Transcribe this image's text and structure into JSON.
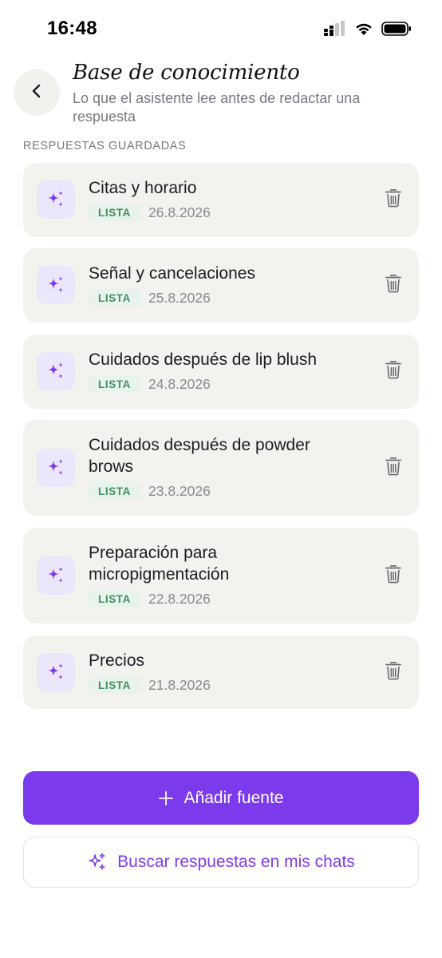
{
  "status_bar": {
    "time": "16:48",
    "icons": [
      "cellular-signal-icon",
      "wifi-icon",
      "battery-icon"
    ]
  },
  "header": {
    "back_icon": "chevron-left-icon",
    "title": "Base de conocimiento",
    "subtitle": "Lo que el asistente lee antes de redactar una respuesta"
  },
  "section_label": "RESPUESTAS GUARDADAS",
  "items": [
    {
      "title": "Citas y horario",
      "badge": "LISTA",
      "date": "26.8.2026"
    },
    {
      "title": "Señal y cancelaciones",
      "badge": "LISTA",
      "date": "25.8.2026"
    },
    {
      "title": "Cuidados después de lip blush",
      "badge": "LISTA",
      "date": "24.8.2026"
    },
    {
      "title": "Cuidados después de powder brows",
      "badge": "LISTA",
      "date": "23.8.2026"
    },
    {
      "title": "Preparación para micropigmentación",
      "badge": "LISTA",
      "date": "22.8.2026"
    },
    {
      "title": "Precios",
      "badge": "LISTA",
      "date": "21.8.2026"
    }
  ],
  "item_icon": "sparkles-icon",
  "delete_icon": "trash-icon",
  "actions": {
    "add_source_label": "Añadir fuente",
    "search_label": "Buscar respuestas en mis chats"
  },
  "colors": {
    "accent": "#7c3aed",
    "badge_bg": "#e7f3ec",
    "badge_text": "#3f8f61",
    "card_bg": "#f3f2ef",
    "icon_tile_bg": "#ece6fb"
  }
}
